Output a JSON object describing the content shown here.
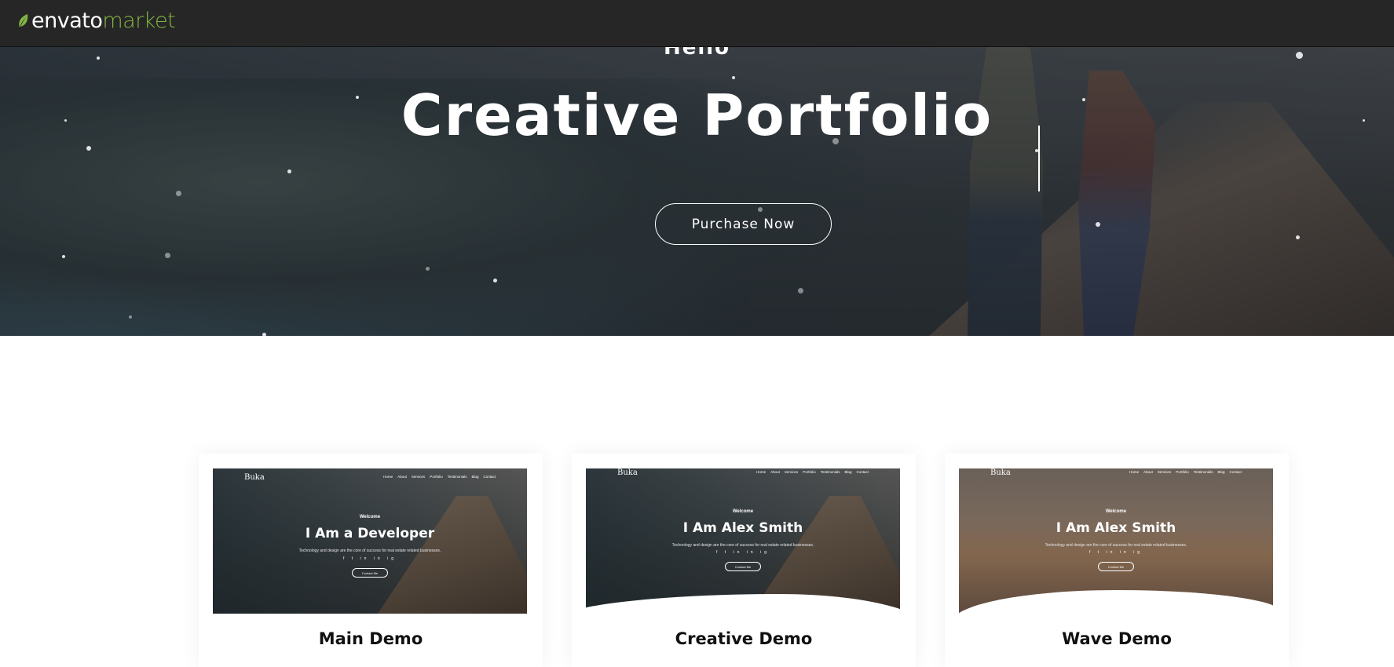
{
  "topbar": {
    "logo_envato": "envato",
    "logo_market": "market"
  },
  "hero": {
    "hello": "Hello",
    "title": "Creative Portfolio",
    "button_label": "Purchase Now"
  },
  "colors": {
    "topbar_bg": "#262626",
    "brand_green": "#82b541",
    "page_bg": "#ffffff"
  },
  "demos": [
    {
      "label": "Main Demo",
      "preview": {
        "brand": "Buka",
        "nav": [
          "Home",
          "About",
          "Services",
          "Portfolio",
          "Testimonials",
          "Blog",
          "Contact"
        ],
        "welcome": "Welcome",
        "title": "I Am a Developer",
        "subtitle": "Technology and design are the core of success for real estate related businesses.",
        "social": "f  t  in  in  ig",
        "button": "Contact Me"
      }
    },
    {
      "label": "Creative Demo",
      "preview": {
        "brand": "Buka",
        "nav": [
          "Home",
          "About",
          "Services",
          "Portfolio",
          "Testimonials",
          "Blog",
          "Contact"
        ],
        "welcome": "Welcome",
        "title": "I Am Alex Smith",
        "subtitle": "Technology and design are the core of success for real estate related businesses.",
        "social": "f  t  in  in  ig",
        "button": "Contact Me"
      }
    },
    {
      "label": "Wave Demo",
      "preview": {
        "brand": "Buka",
        "nav": [
          "Home",
          "About",
          "Services",
          "Portfolio",
          "Testimonials",
          "Blog",
          "Contact"
        ],
        "welcome": "Welcome",
        "title": "I Am Alex Smith",
        "subtitle": "Technology and design are the core of success for real estate related businesses.",
        "social": "f  t  in  in  ig",
        "button": "Contact Me"
      }
    }
  ]
}
